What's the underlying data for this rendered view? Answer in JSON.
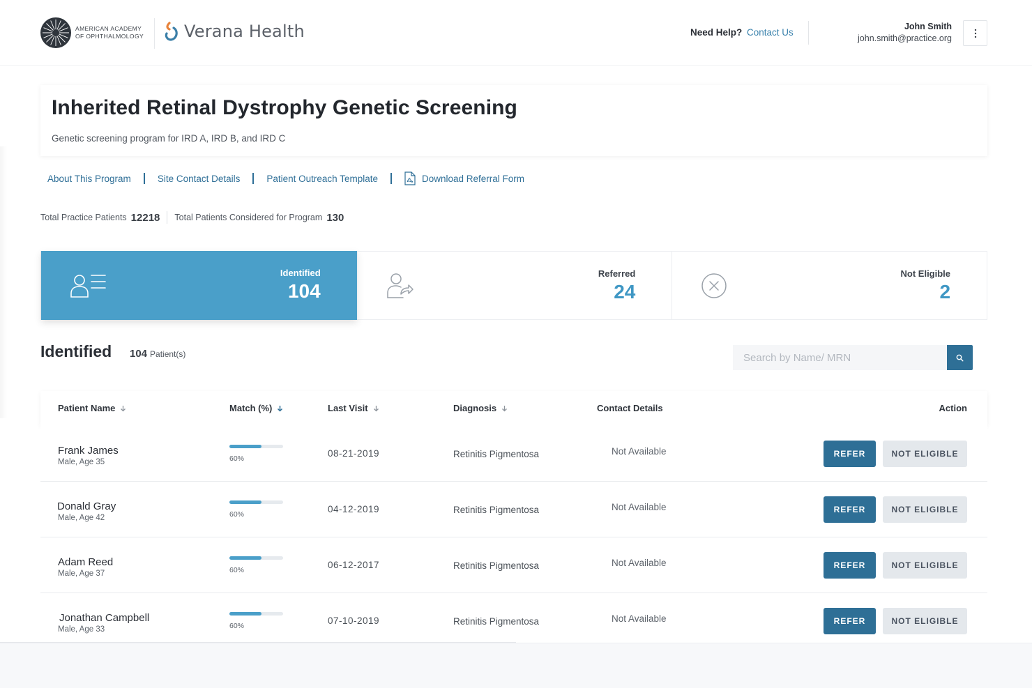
{
  "header": {
    "org_line1": "AMERICAN ACADEMY",
    "org_line2": "OF OPHTHALMOLOGY",
    "brand": "Verana Health",
    "help_label": "Need Help?",
    "help_link": "Contact Us",
    "user_name": "John Smith",
    "user_email": "john.smith@practice.org"
  },
  "program": {
    "title": "Inherited Retinal Dystrophy Genetic Screening",
    "subtitle": "Genetic screening program for IRD A, IRD B, and IRD C",
    "links": [
      "About This Program",
      "Site Contact Details",
      "Patient Outreach Template",
      "Download Referral Form"
    ]
  },
  "totals": {
    "practice_label": "Total Practice Patients",
    "practice_value": "12218",
    "considered_label": "Total Patients Considered for Program",
    "considered_value": "130"
  },
  "status_cards": [
    {
      "label": "Identified",
      "count": "104",
      "icon": "person-list-icon",
      "active": true
    },
    {
      "label": "Referred",
      "count": "24",
      "icon": "person-share-icon",
      "active": false
    },
    {
      "label": "Not Eligible",
      "count": "2",
      "icon": "close-circle-icon",
      "active": false
    }
  ],
  "section": {
    "title": "Identified",
    "count": "104",
    "count_unit": "Patient(s)"
  },
  "search": {
    "placeholder": "Search by Name/ MRN",
    "icon": "search-icon"
  },
  "table": {
    "columns": [
      "Patient Name",
      "Match (%)",
      "Last Visit",
      "Diagnosis",
      "Contact Details",
      "Action"
    ],
    "rows": [
      {
        "name": "Frank James",
        "meta": "Male, Age 35",
        "match": 0.6,
        "match_text": "60%",
        "last_visit": "08-21-2019",
        "diagnosis": "Retinitis Pigmentosa",
        "contact": "Not Available"
      },
      {
        "name": "Donald Gray",
        "meta": "Male, Age 42",
        "match": 0.6,
        "match_text": "60%",
        "last_visit": "04-12-2019",
        "diagnosis": "Retinitis Pigmentosa",
        "contact": "Not Available"
      },
      {
        "name": "Adam Reed",
        "meta": "Male, Age 37",
        "match": 0.6,
        "match_text": "60%",
        "last_visit": "06-12-2017",
        "diagnosis": "Retinitis Pigmentosa",
        "contact": "Not Available"
      },
      {
        "name": "Jonathan Campbell",
        "meta": "Male, Age 33",
        "match": 0.6,
        "match_text": "60%",
        "last_visit": "07-10-2019",
        "diagnosis": "Retinitis Pigmentosa",
        "contact": "Not Available"
      }
    ],
    "refer_label": "REFER",
    "not_eligible_label": "NOT ELIGIBLE"
  },
  "colors": {
    "accent": "#4a9fc9",
    "primary_button": "#2e6f96",
    "link": "#2f6f97",
    "secondary_button": "#e4e8ec",
    "brand_orange": "#e8833a"
  }
}
